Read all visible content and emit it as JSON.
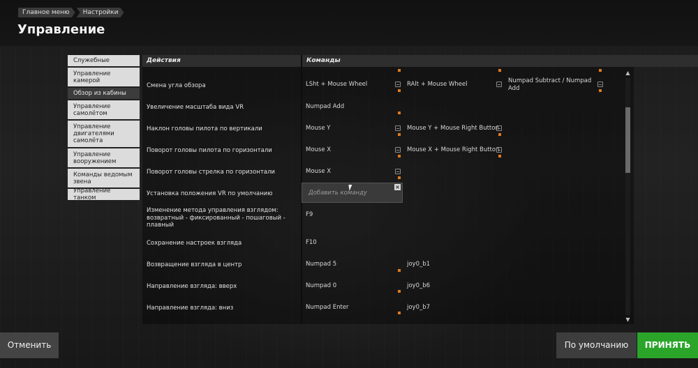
{
  "breadcrumb": [
    "Главное меню",
    "Настройки"
  ],
  "page_title": "Управление",
  "sidebar": {
    "items": [
      {
        "label": "Служебные",
        "active": false
      },
      {
        "label": "Управление камерой",
        "active": false
      },
      {
        "label": "Обзор из кабины",
        "active": true
      },
      {
        "label": "Управление самолётом",
        "active": false
      },
      {
        "label": "Управление двигателями самолёта",
        "active": false
      },
      {
        "label": "Управление вооружением",
        "active": false
      },
      {
        "label": "Команды ведомым звена",
        "active": false
      },
      {
        "label": "Управление танком",
        "active": false
      }
    ]
  },
  "table": {
    "headers": {
      "actions": "Действия",
      "commands": "Команды"
    },
    "rows": [
      {
        "action": "Смена угла обзора",
        "commands": [
          "LSht + Mouse Wheel",
          "RAlt + Mouse Wheel",
          "Numpad Subtract / Numpad Add"
        ]
      },
      {
        "action": "Увеличение масштаба вида VR",
        "commands": [
          "Numpad Add"
        ]
      },
      {
        "action": "Наклон головы пилота по вертикали",
        "commands": [
          "Mouse Y",
          "Mouse Y + Mouse Right Button"
        ]
      },
      {
        "action": "Поворот головы пилота по горизонтали",
        "commands": [
          "Mouse X",
          "Mouse X + Mouse Right Button"
        ]
      },
      {
        "action": "Поворот головы стрелка по горизонтали",
        "commands": [
          "Mouse X"
        ]
      },
      {
        "action": "Установка положения VR по умолчанию",
        "commands": []
      },
      {
        "action": "Изменение метода управления взглядом: возвратный - фиксированный - пошаговый - плавный",
        "commands": [
          "F9"
        ]
      },
      {
        "action": "Сохранение настроек взгляда",
        "commands": [
          "F10"
        ]
      },
      {
        "action": "Возвращение взгляда в центр",
        "commands": [
          "Numpad 5",
          "joy0_b1"
        ]
      },
      {
        "action": "Направление взгляда: вверх",
        "commands": [
          "Numpad 0",
          "joy0_b6"
        ]
      },
      {
        "action": "Направление взгляда: вниз",
        "commands": [
          "Numpad Enter",
          "joy0_b7"
        ]
      }
    ]
  },
  "add_command_popup": {
    "placeholder": "Добавить команду",
    "close_glyph": "×"
  },
  "buttons": {
    "cancel": "Отменить",
    "default": "По умолчанию",
    "apply": "ПРИНЯТЬ"
  },
  "colors": {
    "accent_orange": "#e0781e",
    "apply_green": "#2aa52a",
    "sidebar_item": "#dcdcdc",
    "sidebar_active": "#3c3c3c"
  },
  "icons": {
    "delete": "delete-binding-icon",
    "binding_marker": "binding-marker-icon",
    "scroll_up": "▲",
    "scroll_down": "▼"
  }
}
